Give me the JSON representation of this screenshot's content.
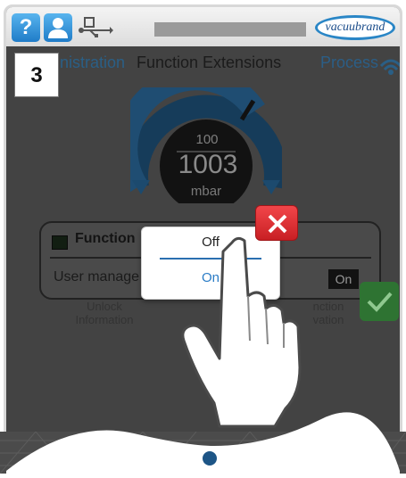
{
  "step": "3",
  "status_bar": {
    "help_icon": "question-mark",
    "user_icon": "user-silhouette",
    "usb_icon": "usb-plug",
    "logo_text": "vacuubrand"
  },
  "tabs": [
    {
      "label": "inistration"
    },
    {
      "label": "Function Extensions"
    },
    {
      "label": "Process"
    }
  ],
  "gauge": {
    "max": "100",
    "value": "1003",
    "unit": "mbar",
    "needle_fraction": 0.72
  },
  "panel": {
    "title": "Function",
    "row_label": "User manage",
    "row_button": "On"
  },
  "labels": {
    "unlock_line1": "Unlock",
    "unlock_line2": "Information",
    "right_line1": "nction",
    "right_line2": "vation"
  },
  "popup": {
    "option_off": "Off",
    "option_on": "On"
  },
  "colors": {
    "accent": "#2a7cc6",
    "close": "#e12b30",
    "confirm": "#2e7332"
  }
}
